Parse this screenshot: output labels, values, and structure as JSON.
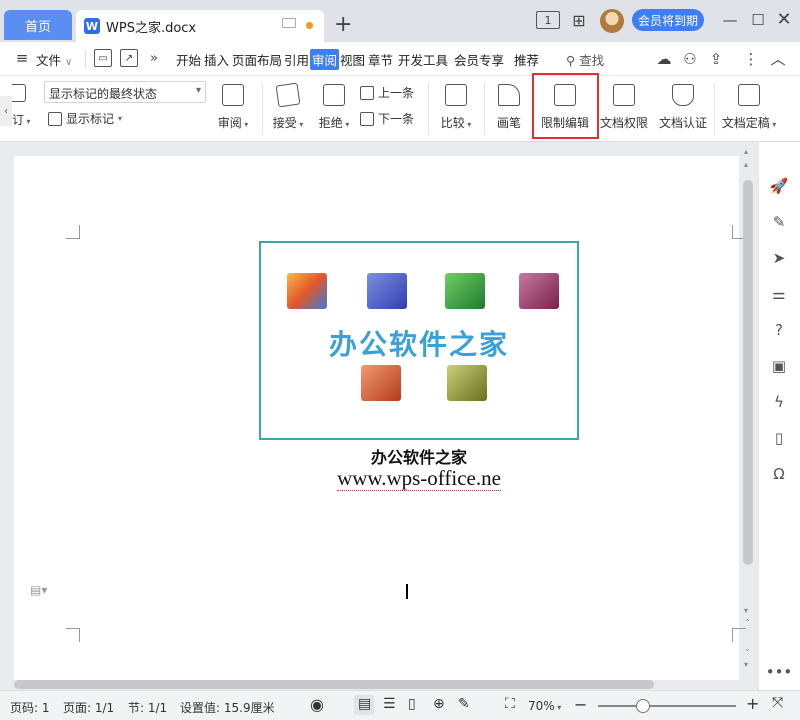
{
  "titlebar": {
    "home_tab": "首页",
    "doc_tab": "WPS之家.docx",
    "new_tab": "+",
    "page_badge": "1",
    "member_button": "会员将到期",
    "icons": [
      "apps-icon",
      "minimize-icon",
      "maximize-icon",
      "close-icon"
    ]
  },
  "menubar": {
    "file": "文件",
    "items": [
      "开始",
      "插入",
      "页面布局",
      "引用",
      "审阅",
      "视图",
      "章节",
      "开发工具",
      "会员专享",
      "推荐"
    ],
    "active": "审阅",
    "search": "查找"
  },
  "ribbon": {
    "partial_label": "订",
    "markup_state": "显示标记的最终状态",
    "show_markup": "显示标记",
    "review": "审阅",
    "accept": "接受",
    "reject": "拒绝",
    "prev": "上一条",
    "next": "下一条",
    "compare": "比较",
    "pen": "画笔",
    "restrict_edit": "限制编辑",
    "doc_permission": "文档权限",
    "doc_certify": "文档认证",
    "doc_finalize": "文档定稿"
  },
  "document": {
    "logo_title": "办公软件之家",
    "caption": "办公软件之家",
    "url": "www.wps-office.ne"
  },
  "statusbar": {
    "page_num": "页码: 1",
    "pages": "页面: 1/1",
    "section": "节: 1/1",
    "setting": "设置值: 15.9厘米",
    "zoom": "70%"
  },
  "colors": {
    "accent": "#3f7ef0",
    "highlight_border": "#e23030",
    "logo_border": "#3aa7b0"
  }
}
